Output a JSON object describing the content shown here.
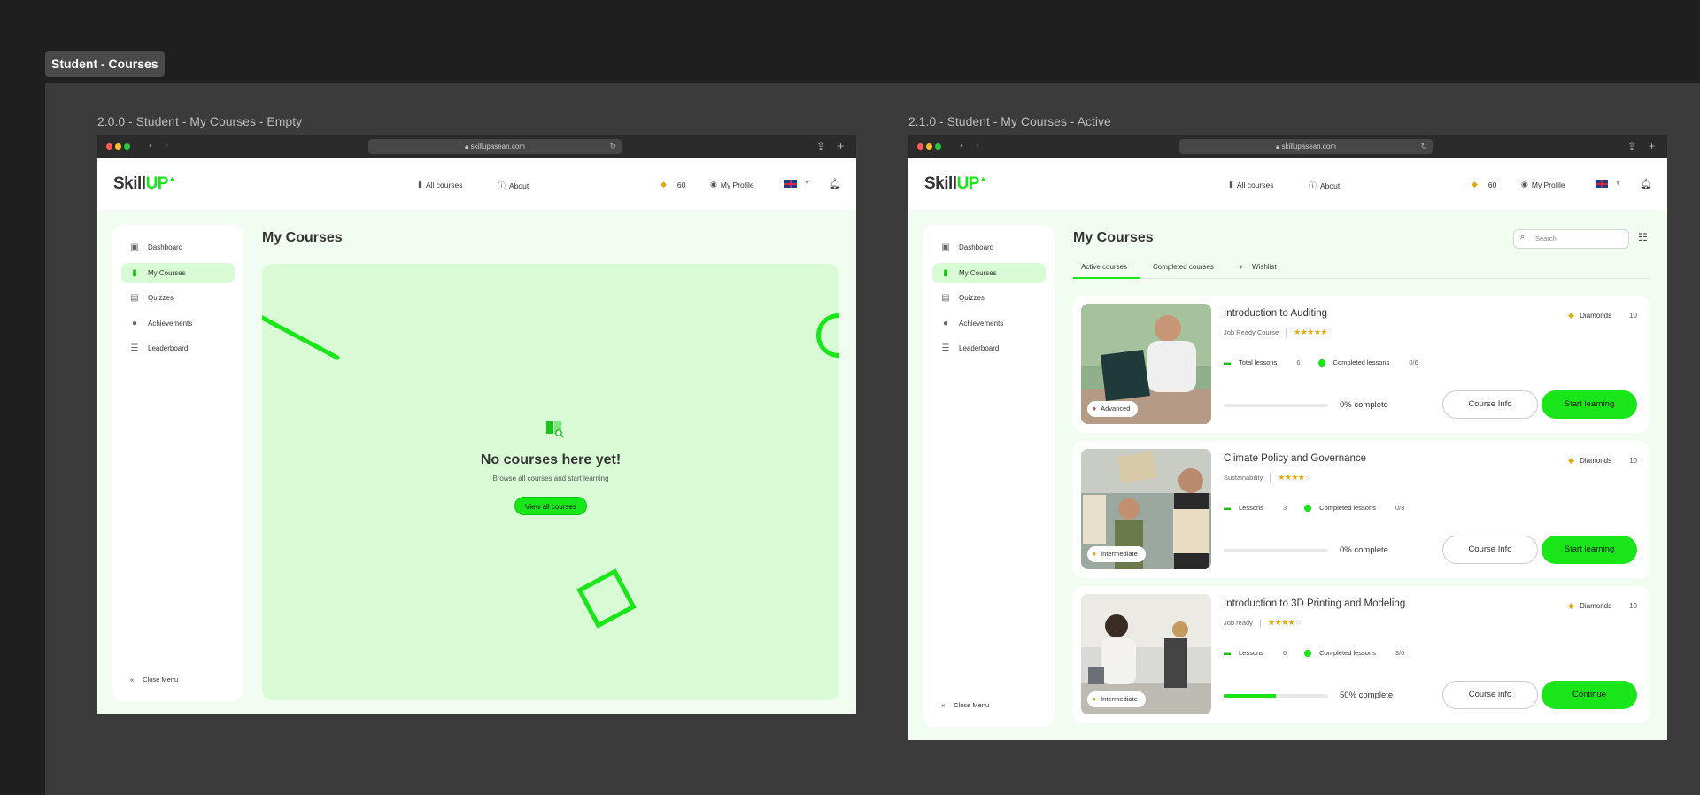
{
  "section_tag": "Student - Courses",
  "frames": {
    "empty_label": "2.0.0 - Student - My Courses - Empty",
    "active_label": "2.1.0 - Student - My Courses - Active"
  },
  "browser": {
    "url": "skillupasean.com"
  },
  "logo": {
    "part1": "Skill",
    "part2": "UP",
    "mark": "▲"
  },
  "topnav": {
    "all_courses": "All courses",
    "about": "About",
    "diamonds": "60",
    "profile": "My Profile"
  },
  "sidebar": {
    "items": [
      {
        "label": "Dashboard",
        "icon": "dashboard-icon"
      },
      {
        "label": "My Courses",
        "icon": "book-icon"
      },
      {
        "label": "Quizzes",
        "icon": "clipboard-icon"
      },
      {
        "label": "Achievements",
        "icon": "medal-icon"
      },
      {
        "label": "Leaderboard",
        "icon": "leaderboard-icon"
      }
    ],
    "close_menu": "Close Menu"
  },
  "page_title": "My Courses",
  "empty_state": {
    "title": "No courses here yet!",
    "subtitle": "Browse all courses and start learning",
    "button": "View all courses"
  },
  "search": {
    "placeholder": "Search"
  },
  "tabs": [
    "Active courses",
    "Completed courses",
    "Wishlist"
  ],
  "courses": [
    {
      "title": "Introduction to Auditing",
      "category": "Job Ready Course",
      "rating": 5,
      "level": "Advanced",
      "diamonds_label": "Diamonds",
      "diamonds": "10",
      "lessons_label": "Total lessons",
      "lessons": "6",
      "completed_label": "Completed lessons",
      "completed": "0/6",
      "progress": 0,
      "progress_label": "0% complete",
      "info_button": "Course Info",
      "action_button": "Start learning",
      "stars": "★★★★★",
      "stars_off": ""
    },
    {
      "title": "Climate Policy and Governance",
      "category": "Sustainability",
      "rating": 4,
      "level": "Intermediate",
      "diamonds_label": "Diamonds",
      "diamonds": "10",
      "lessons_label": "Lessons",
      "lessons": "3",
      "completed_label": "Completed lessons",
      "completed": "0/3",
      "progress": 0,
      "progress_label": "0% complete",
      "info_button": "Course Info",
      "action_button": "Start learning",
      "stars": "★★★★",
      "stars_off": "☆"
    },
    {
      "title": "Introduction to 3D Printing and Modeling",
      "category": "Job ready",
      "rating": 4,
      "level": "Intermediate",
      "diamonds_label": "Diamonds",
      "diamonds": "10",
      "lessons_label": "Lessons",
      "lessons": "6",
      "completed_label": "Completed lessons",
      "completed": "3/6",
      "progress": 50,
      "progress_label": "50% complete",
      "info_button": "Course info",
      "action_button": "Continue",
      "stars": "★★★★",
      "stars_off": "☆"
    }
  ],
  "colors": {
    "accent": "#19e619",
    "panel": "#d8fbd6",
    "page_bg": "#f2fdf1"
  }
}
